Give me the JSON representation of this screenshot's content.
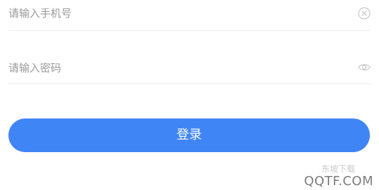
{
  "form": {
    "phone": {
      "placeholder": "请输入手机号",
      "value": "",
      "clear_icon": "clear-circle-icon"
    },
    "password": {
      "placeholder": "请输入密码",
      "value": "",
      "visibility_icon": "eye-icon"
    },
    "login_label": "登录"
  },
  "watermark": {
    "text": "QQTF.COM",
    "subtext": "东坡下载"
  },
  "colors": {
    "primary": "#3f85f6",
    "placeholder": "#9a9a9a",
    "divider": "#ebebeb",
    "icon": "#c6c6c6"
  }
}
